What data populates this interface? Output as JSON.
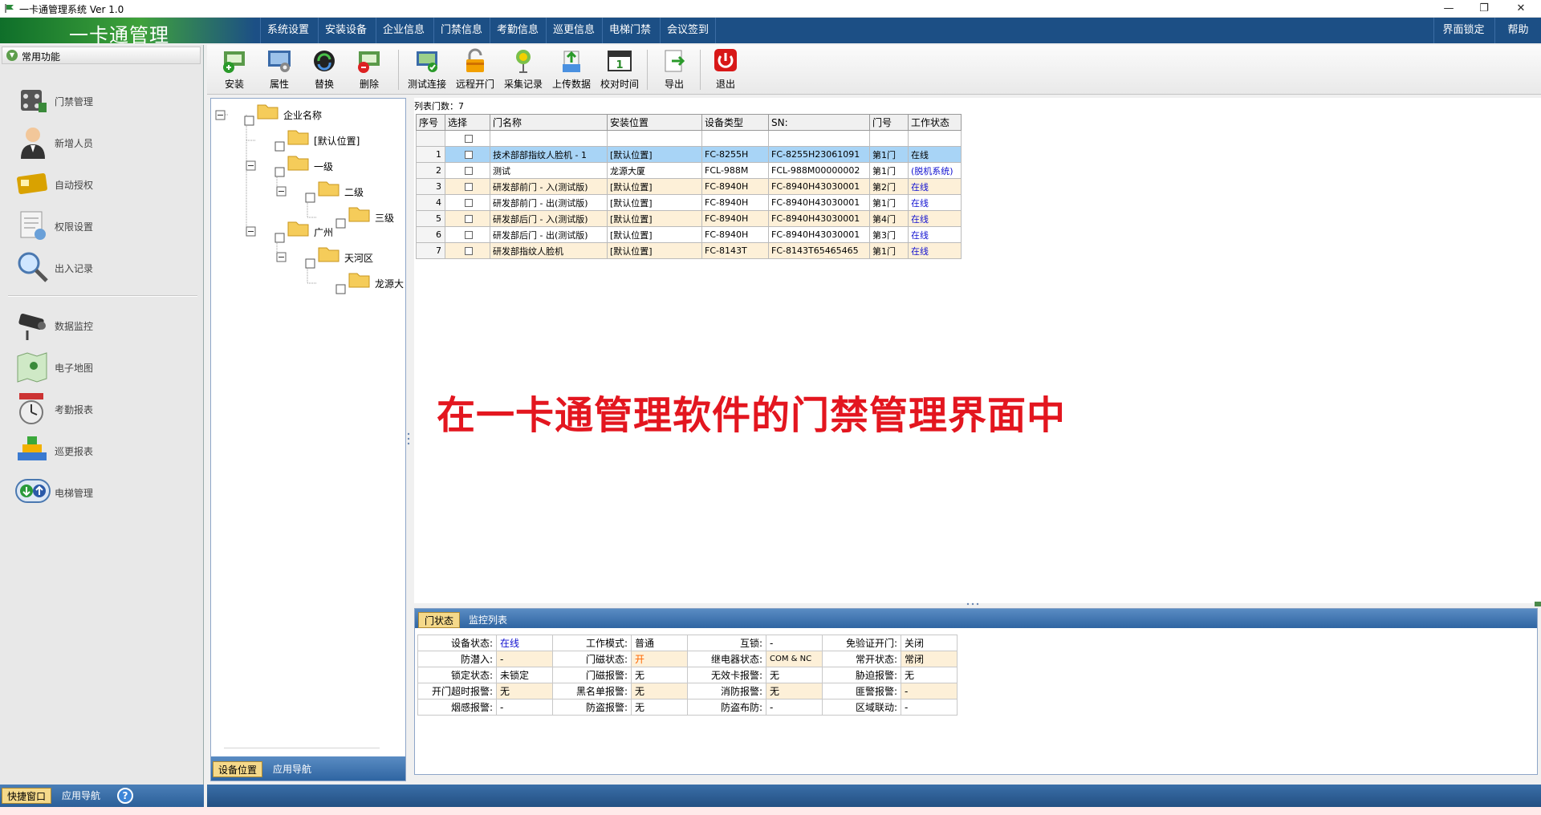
{
  "window": {
    "title": "一卡通管理系统 Ver 1.0",
    "minimize": "—",
    "maximize": "❐",
    "close": "✕"
  },
  "app": {
    "logo_text": "一卡通管理"
  },
  "menu": {
    "items": [
      "系统设置",
      "安装设备",
      "企业信息",
      "门禁信息",
      "考勤信息",
      "巡更信息",
      "电梯门禁",
      "会议签到"
    ],
    "lock_screen": "界面锁定",
    "help": "帮助"
  },
  "sidebar": {
    "header": "常用功能",
    "items": [
      {
        "label": "门禁管理",
        "icon": "door-control-icon"
      },
      {
        "label": "新增人员",
        "icon": "person-icon"
      },
      {
        "label": "自动授权",
        "icon": "card-icon"
      },
      {
        "label": "权限设置",
        "icon": "permission-icon"
      },
      {
        "label": "出入记录",
        "icon": "magnifier-icon"
      },
      {
        "label": "数据监控",
        "icon": "camera-icon"
      },
      {
        "label": "电子地图",
        "icon": "map-icon"
      },
      {
        "label": "考勤报表",
        "icon": "clock-icon"
      },
      {
        "label": "巡更报表",
        "icon": "patrol-icon"
      },
      {
        "label": "电梯管理",
        "icon": "elevator-icon"
      }
    ],
    "footer": {
      "tab_quick": "快捷窗口",
      "tab_nav": "应用导航",
      "help_glyph": "?"
    }
  },
  "toolbar": {
    "buttons": [
      {
        "label": "安装",
        "icon": "install-icon"
      },
      {
        "label": "属性",
        "icon": "properties-icon"
      },
      {
        "label": "替换",
        "icon": "replace-icon"
      },
      {
        "label": "删除",
        "icon": "delete-icon"
      },
      {
        "label": "测试连接",
        "icon": "test-connection-icon"
      },
      {
        "label": "远程开门",
        "icon": "remote-open-icon"
      },
      {
        "label": "采集记录",
        "icon": "collect-records-icon"
      },
      {
        "label": "上传数据",
        "icon": "upload-data-icon"
      },
      {
        "label": "校对时间",
        "icon": "calendar-icon"
      },
      {
        "label": "导出",
        "icon": "export-icon"
      },
      {
        "label": "退出",
        "icon": "power-icon"
      }
    ]
  },
  "tree": {
    "nodes": [
      {
        "label": "企业名称",
        "expanded": true
      },
      {
        "label": "[默认位置]"
      },
      {
        "label": "一级",
        "expanded": true
      },
      {
        "label": "二级",
        "expanded": true
      },
      {
        "label": "三级"
      },
      {
        "label": "广州",
        "expanded": true
      },
      {
        "label": "天河区",
        "expanded": true
      },
      {
        "label": "龙源大"
      }
    ],
    "footer": {
      "tab_location": "设备位置",
      "tab_nav": "应用导航"
    }
  },
  "doors": {
    "count_label": "列表门数：7",
    "columns": [
      "序号",
      "选择",
      "门名称",
      "安装位置",
      "设备类型",
      "SN:",
      "门号",
      "工作状态"
    ],
    "rows": [
      {
        "no": "1",
        "name": "技术部部指纹人脸机 - 1",
        "location": "[默认位置]",
        "type": "FC-8255H",
        "sn": "FC-8255H23061091",
        "door": "第1门",
        "status": "在线",
        "selected": true
      },
      {
        "no": "2",
        "name": "测试",
        "location": "龙源大厦",
        "type": "FCL-988M",
        "sn": "FCL-988M00000002",
        "door": "第1门",
        "status": "(脱机系统)"
      },
      {
        "no": "3",
        "name": "研发部前门 - 入(测试版)",
        "location": "[默认位置]",
        "type": "FC-8940H",
        "sn": "FC-8940H43030001",
        "door": "第2门",
        "status": "在线"
      },
      {
        "no": "4",
        "name": "研发部前门 - 出(测试版)",
        "location": "[默认位置]",
        "type": "FC-8940H",
        "sn": "FC-8940H43030001",
        "door": "第1门",
        "status": "在线"
      },
      {
        "no": "5",
        "name": "研发部后门 - 入(测试版)",
        "location": "[默认位置]",
        "type": "FC-8940H",
        "sn": "FC-8940H43030001",
        "door": "第4门",
        "status": "在线"
      },
      {
        "no": "6",
        "name": "研发部后门 - 出(测试版)",
        "location": "[默认位置]",
        "type": "FC-8940H",
        "sn": "FC-8940H43030001",
        "door": "第3门",
        "status": "在线"
      },
      {
        "no": "7",
        "name": "研发部指纹人脸机",
        "location": "[默认位置]",
        "type": "FC-8143T",
        "sn": "FC-8143T65465465",
        "door": "第1门",
        "status": "在线"
      }
    ]
  },
  "caption": "在一卡通管理软件的门禁管理界面中",
  "status_panel": {
    "tabs": [
      "门状态",
      "监控列表"
    ],
    "rows": [
      [
        [
          "设备状态:",
          "在线"
        ],
        [
          "工作模式:",
          "普通"
        ],
        [
          "互锁:",
          "-"
        ],
        [
          "免验证开门:",
          "关闭"
        ]
      ],
      [
        [
          "防潜入:",
          "-"
        ],
        [
          "门磁状态:",
          "开"
        ],
        [
          "继电器状态:",
          "COM & NC"
        ],
        [
          "常开状态:",
          "常闭"
        ]
      ],
      [
        [
          "锁定状态:",
          "未锁定"
        ],
        [
          "门磁报警:",
          "无"
        ],
        [
          "无效卡报警:",
          "无"
        ],
        [
          "胁迫报警:",
          "无"
        ]
      ],
      [
        [
          "开门超时报警:",
          "无"
        ],
        [
          "黑名单报警:",
          "无"
        ],
        [
          "消防报警:",
          "无"
        ],
        [
          "匪警报警:",
          "-"
        ]
      ],
      [
        [
          "烟感报警:",
          "-"
        ],
        [
          "防盗报警:",
          "无"
        ],
        [
          "防盗布防:",
          "-"
        ],
        [
          "区域联动:",
          "-"
        ]
      ]
    ]
  },
  "colors": {
    "menu_bg": "#1c4f85",
    "online": "#1010d0",
    "door_open": "#ff6600",
    "caption": "#e3161f",
    "row_alt": "#fdf0d8",
    "row_selected": "#a8d4f6"
  }
}
